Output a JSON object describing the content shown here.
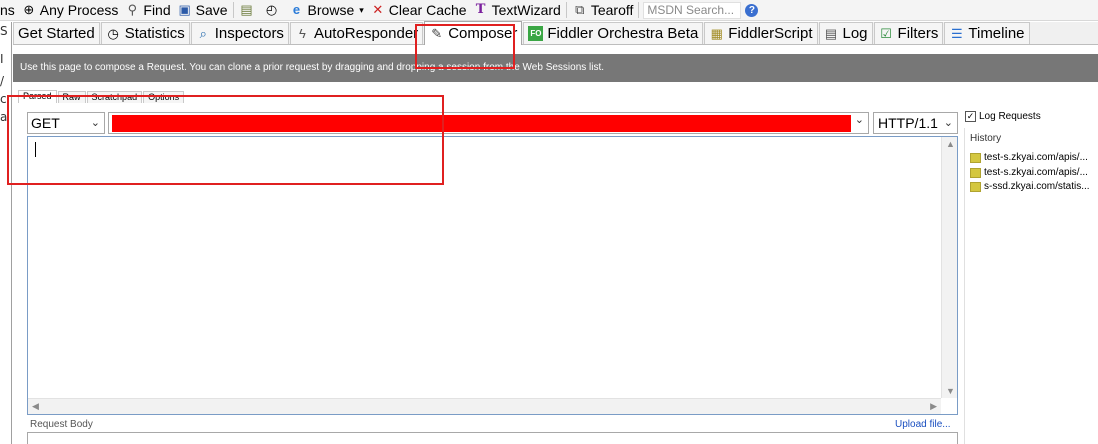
{
  "toolbar": {
    "items": [
      {
        "label": "ns",
        "icon": "truncated"
      },
      {
        "label": "Any Process",
        "icon": "crosshair-icon"
      },
      {
        "label": "Find",
        "icon": "binoculars-icon"
      },
      {
        "label": "Save",
        "icon": "save-icon"
      },
      {
        "label": "",
        "icon": "clipboard-icon"
      },
      {
        "label": "",
        "icon": "timer-icon"
      },
      {
        "label": "Browse",
        "icon": "ie-icon"
      },
      {
        "label": "Clear Cache",
        "icon": "clear-icon"
      },
      {
        "label": "TextWizard",
        "icon": "textwizard-icon"
      },
      {
        "label": "Tearoff",
        "icon": "tearoff-icon"
      }
    ],
    "search_placeholder": "MSDN Search..."
  },
  "left_strip": {
    "fragments": [
      "S",
      "I",
      "/",
      "c",
      "a"
    ]
  },
  "main_tabs": [
    {
      "label": "Get Started",
      "icon": ""
    },
    {
      "label": "Statistics",
      "icon": "stopwatch-icon"
    },
    {
      "label": "Inspectors",
      "icon": "inspector-icon"
    },
    {
      "label": "AutoResponder",
      "icon": "lightning-icon"
    },
    {
      "label": "Composer",
      "icon": "composer-icon",
      "active": true
    },
    {
      "label": "Fiddler Orchestra Beta",
      "icon": "fo-icon"
    },
    {
      "label": "FiddlerScript",
      "icon": "script-icon"
    },
    {
      "label": "Log",
      "icon": "log-icon"
    },
    {
      "label": "Filters",
      "icon": "checkbox-icon"
    },
    {
      "label": "Timeline",
      "icon": "timeline-icon"
    }
  ],
  "info_text": "Use this page to compose a Request. You can clone a prior request by dragging and dropping a session from the Web Sessions list.",
  "sub_tabs": [
    {
      "label": "Parsed",
      "active": true
    },
    {
      "label": "Raw"
    },
    {
      "label": "Scratchpad"
    },
    {
      "label": "Options"
    }
  ],
  "request": {
    "method": "GET",
    "url": "",
    "version": "HTTP/1.1"
  },
  "body": {
    "label": "Request Body",
    "upload_link": "Upload file..."
  },
  "history": {
    "log_requests_label": "Log Requests",
    "log_requests_checked": true,
    "title": "History",
    "items": [
      "test-s.zkyai.com/apis/...",
      "test-s.zkyai.com/apis/...",
      "s-ssd.zkyai.com/statis..."
    ]
  },
  "colors": {
    "highlight": "#e02020",
    "redacted": "#ff0000",
    "info_bar": "#777777"
  }
}
